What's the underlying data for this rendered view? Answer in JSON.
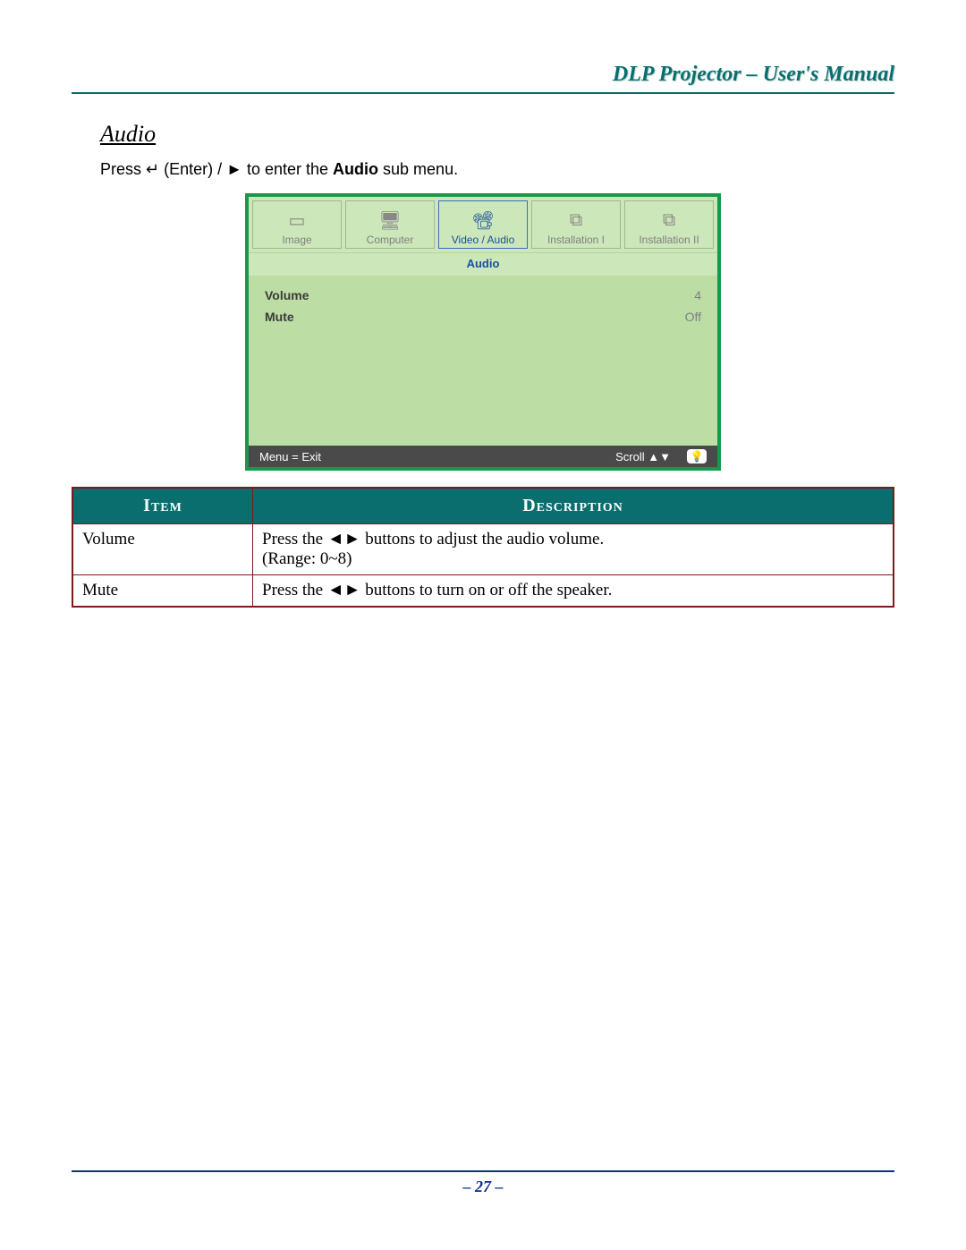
{
  "header": {
    "title": "DLP Projector – User's Manual"
  },
  "section": {
    "heading": "Audio"
  },
  "instruction": {
    "prefix": "Press ",
    "enter_symbol": "↵",
    "middle": " (Enter) / ",
    "right_symbol": "►",
    "after_symbol": " to enter the ",
    "bold_word": "Audio",
    "suffix": " sub menu."
  },
  "osd": {
    "tabs": [
      {
        "name": "image",
        "label": "Image",
        "icon": "▭",
        "active": false
      },
      {
        "name": "computer",
        "label": "Computer",
        "icon": "🖥",
        "active": false
      },
      {
        "name": "video-audio",
        "label": "Video / Audio",
        "icon": "📽",
        "active": true
      },
      {
        "name": "installation-1",
        "label": "Installation I",
        "icon": "⧉",
        "active": false
      },
      {
        "name": "installation-2",
        "label": "Installation II",
        "icon": "⧉",
        "active": false
      }
    ],
    "subtitle": "Audio",
    "rows": [
      {
        "label": "Volume",
        "value": "4"
      },
      {
        "label": "Mute",
        "value": "Off"
      }
    ],
    "footer": {
      "left": "Menu = Exit",
      "scroll_prefix": "Scroll ",
      "scroll_symbols": "▲▼",
      "bulb_icon": "💡"
    }
  },
  "table": {
    "headers": {
      "item": "Item",
      "description": "Description"
    },
    "rows": [
      {
        "item": "Volume",
        "desc_prefix": "Press the ",
        "desc_arrows": "◄►",
        "desc_suffix": " buttons to adjust the audio volume.",
        "range": "(Range: 0~8)"
      },
      {
        "item": "Mute",
        "desc_prefix": "Press the ",
        "desc_arrows": "◄►",
        "desc_suffix": " buttons to turn on or off the speaker.",
        "range": ""
      }
    ]
  },
  "footer": {
    "page_number": "– 27 –"
  }
}
